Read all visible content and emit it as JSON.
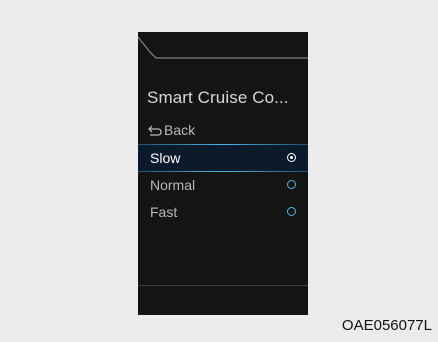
{
  "menu": {
    "title": "Smart Cruise Co...",
    "back_label": "Back",
    "options": [
      {
        "label": "Slow",
        "selected": true
      },
      {
        "label": "Normal",
        "selected": false
      },
      {
        "label": "Fast",
        "selected": false
      }
    ]
  },
  "colors": {
    "highlight_line": "#4fb6e6",
    "radio_accent": "#4fb6e6"
  },
  "caption": "OAE056077L"
}
